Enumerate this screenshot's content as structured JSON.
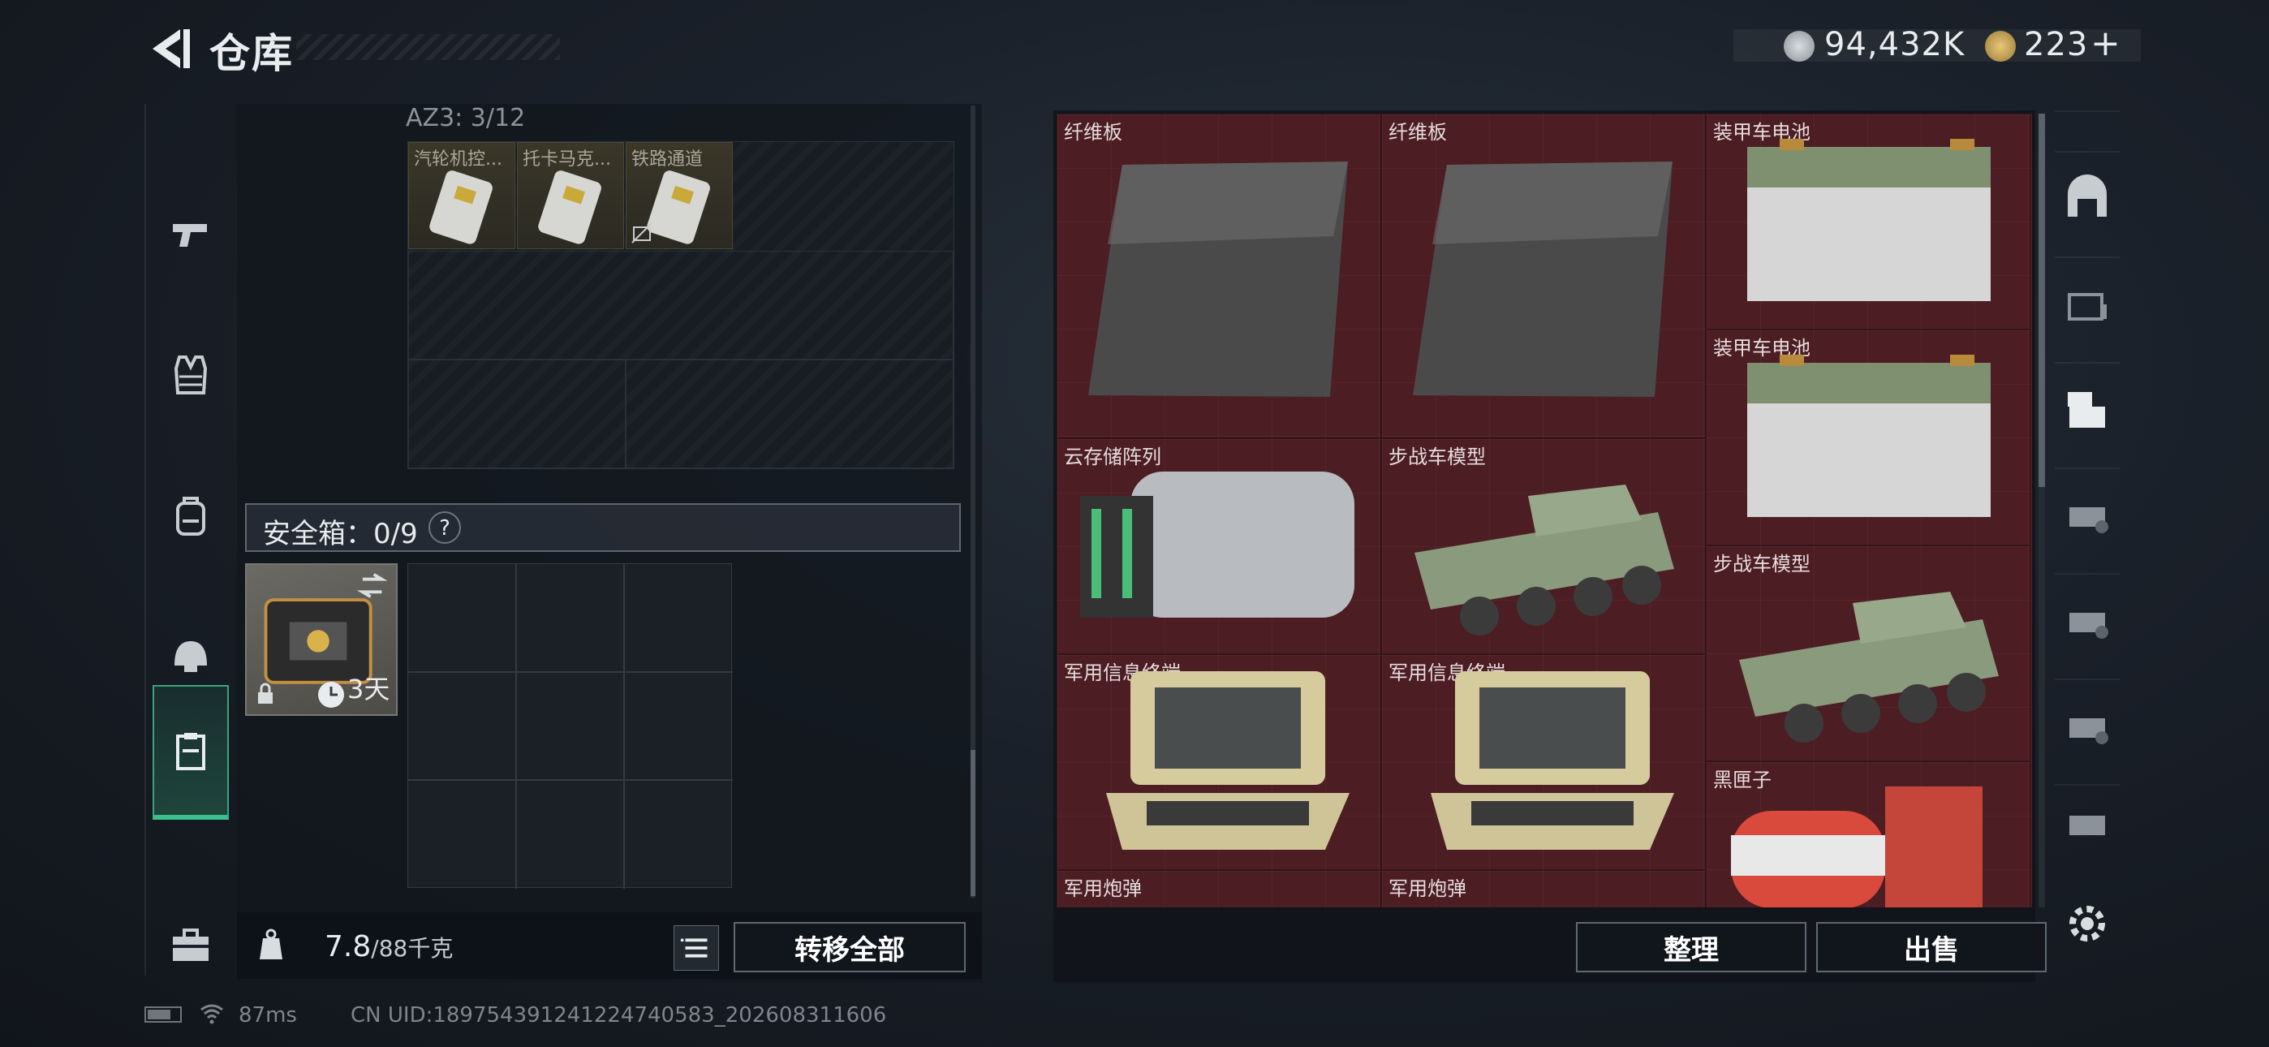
{
  "header": {
    "title": "仓库",
    "currency_main": "94,432K",
    "currency_premium": "223",
    "premium_plus": "+"
  },
  "nav": {
    "items": [
      {
        "name": "weapon",
        "icon": "pistol-icon"
      },
      {
        "name": "armor",
        "icon": "vest-icon"
      },
      {
        "name": "backpack",
        "icon": "backpack-icon"
      },
      {
        "name": "helmet",
        "icon": "helmet-icon"
      },
      {
        "name": "stash",
        "icon": "case-icon",
        "active": true
      },
      {
        "name": "toolbox",
        "icon": "toolbox-icon"
      }
    ]
  },
  "inventory": {
    "az_label": "AZ3: 3/12",
    "items": [
      {
        "label": "汽轮机控..."
      },
      {
        "label": "托卡马克..."
      },
      {
        "label": "铁路通道"
      }
    ],
    "safe_box_label": "安全箱：0/9",
    "help": "?",
    "case_timer": "3天",
    "weight_value": "7.8",
    "weight_max": "/88千克",
    "transfer_all": "转移全部"
  },
  "stash": {
    "items": [
      {
        "label": "纤维板"
      },
      {
        "label": "纤维板"
      },
      {
        "label": "装甲车电池"
      },
      {
        "label": "装甲车电池"
      },
      {
        "label": "云存储阵列"
      },
      {
        "label": "步战车模型"
      },
      {
        "label": "步战车模型"
      },
      {
        "label": "军用信息终端"
      },
      {
        "label": "军用信息终端"
      },
      {
        "label": "黑匣子"
      },
      {
        "label": "军用炮弹"
      },
      {
        "label": "军用炮弹"
      }
    ],
    "organize": "整理",
    "sell": "出售"
  },
  "footer": {
    "ping": "87ms",
    "uid": "CN UID:1897543912412247405​83_202608311606"
  },
  "colors": {
    "stash_bg": "#4c1d23",
    "accent_green": "#3bbf8d"
  }
}
